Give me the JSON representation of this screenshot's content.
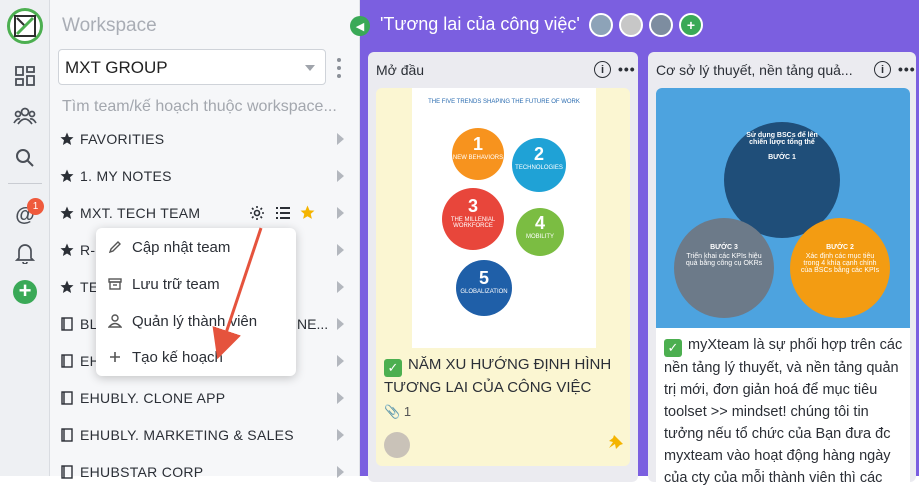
{
  "sidebar": {
    "workspace_label": "Workspace",
    "group_name": "MXT GROUP",
    "search_placeholder": "Tìm team/kế hoạch thuộc workspace...",
    "items": [
      {
        "label": "FAVORITIES"
      },
      {
        "label": "1. MY NOTES"
      },
      {
        "label": "MXT. TECH TEAM"
      },
      {
        "label": "R-"
      },
      {
        "label": "TE"
      },
      {
        "label": "BL"
      },
      {
        "label": "EH"
      },
      {
        "label": "EHUBLY. CLONE APP"
      },
      {
        "label": "EHUBLY. MARKETING & SALES"
      },
      {
        "label": "EHUBSTAR CORP"
      }
    ],
    "item5_suffix": "NE..."
  },
  "context_menu": {
    "items": [
      {
        "label": "Cập nhật team",
        "icon": "pencil-icon"
      },
      {
        "label": "Lưu trữ team",
        "icon": "archive-icon"
      },
      {
        "label": "Quản lý thành viên",
        "icon": "user-icon"
      },
      {
        "label": "Tạo kế hoạch",
        "icon": "plus-icon"
      }
    ]
  },
  "rail": {
    "notification_count": "1"
  },
  "board": {
    "title": "'Tương lai của công việc'",
    "columns": [
      {
        "title": "Mở đầu",
        "card": {
          "text": "NĂM XU HƯỚNG ĐỊNH HÌNH TƯƠNG LAI CỦA CÔNG VIỆC",
          "attachments": "1",
          "infographic": {
            "header": "THE FIVE TRENDS SHAPING THE FUTURE OF WORK",
            "trends": [
              "NEW BEHAVIORS",
              "TECHNOLOGIES",
              "THE MILLENIAL WORKFORCE",
              "MOBILITY",
              "GLOBALIZATION"
            ],
            "numbers": [
              "1",
              "2",
              "3",
              "4",
              "5"
            ]
          }
        }
      },
      {
        "title": "Cơ sở lý thuyết, nền tảng quả...",
        "card": {
          "text": "myXteam là sự phối hợp trên các nền tảng lý thuyết, và nền tảng quản trị mới, đơn giản hoá để mục tiêu toolset >> mindset! chúng tôi tin tưởng nếu tổ chức của Bạn đưa đc myxteam vào hoạt động hàng ngày của cty của mỗi thành viên thì các",
          "diagram": {
            "top": "Sử dụng BSCs để lên chiến lược tổng thể",
            "step1": "BƯỚC 1",
            "step2": "BƯỚC 2",
            "step2_text": "Xác định các mục tiêu trong 4 khía cạnh chính của BSCs bằng các KPIs",
            "step3": "BƯỚC 3",
            "step3_text": "Triển khai các KPIs hiệu quả bằng công cụ OKRs"
          }
        }
      }
    ]
  },
  "colors": {
    "board_bg": "#7b5fe0",
    "accent_green": "#4caf50",
    "arrow_red": "#e5533d",
    "card_yellow": "#fbf6d2"
  }
}
